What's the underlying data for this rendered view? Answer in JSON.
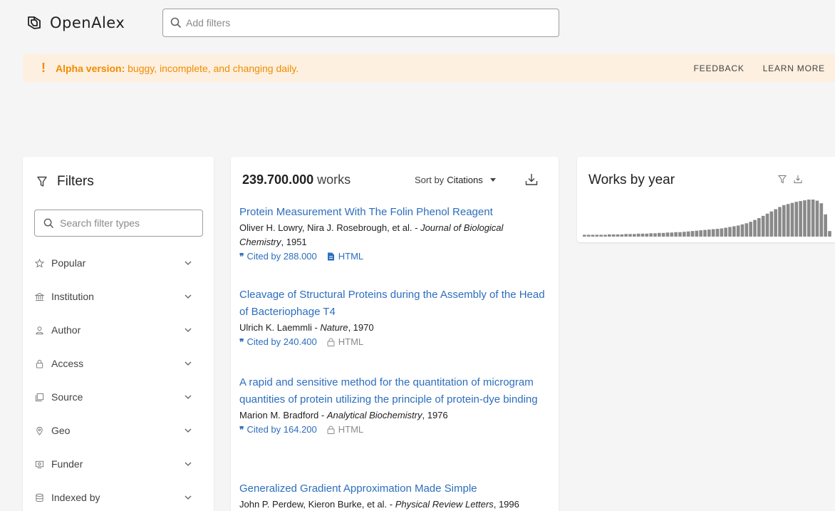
{
  "header": {
    "brand": "OpenAlex",
    "search_placeholder": "Add filters"
  },
  "alpha_banner": {
    "label": "Alpha version:",
    "message": " buggy, incomplete, and changing daily.",
    "feedback": "FEEDBACK",
    "learn_more": "LEARN MORE"
  },
  "filters": {
    "title": "Filters",
    "search_placeholder": "Search filter types",
    "items": [
      {
        "label": "Popular",
        "icon": "star-icon"
      },
      {
        "label": "Institution",
        "icon": "institution-icon"
      },
      {
        "label": "Author",
        "icon": "person-icon"
      },
      {
        "label": "Access",
        "icon": "lock-icon"
      },
      {
        "label": "Source",
        "icon": "source-icon"
      },
      {
        "label": "Geo",
        "icon": "location-icon"
      },
      {
        "label": "Funder",
        "icon": "funder-icon"
      },
      {
        "label": "Indexed by",
        "icon": "database-icon"
      }
    ]
  },
  "results": {
    "count": "239.700.000",
    "count_unit": " works",
    "sort_label": "Sort by",
    "sort_value": "Citations",
    "works": [
      {
        "title": "Protein Measurement With The Folin Phenol Reagent",
        "authors": "Oliver H. Lowry, Nira J. Rosebrough, et al. - ",
        "venue": "Journal of Biological Chemistry",
        "year": ", 1951",
        "cited": "Cited by 288.000",
        "html": "HTML",
        "open_access": true
      },
      {
        "title": "Cleavage of Structural Proteins during the Assembly of the Head of Bacteriophage T4",
        "authors": "Ulrich K. Laemmli - ",
        "venue": "Nature",
        "year": ", 1970",
        "cited": "Cited by 240.400",
        "html": "HTML",
        "open_access": false
      },
      {
        "title": "A rapid and sensitive method for the quantitation of microgram quantities of protein utilizing the principle of protein-dye binding",
        "authors": "Marion M. Bradford - ",
        "venue": "Analytical Biochemistry",
        "year": ", 1976",
        "cited": "Cited by 164.200",
        "html": "HTML",
        "open_access": false
      },
      {
        "title": "Generalized Gradient Approximation Made Simple",
        "authors": "John P. Perdew, Kieron Burke, et al. - ",
        "venue": "Physical Review Letters",
        "year": ", 1996",
        "cited": "",
        "html": "",
        "open_access": true
      }
    ]
  },
  "works_by_year": {
    "title": "Works by year",
    "bar_color": "#8a8a8a",
    "relative_heights": [
      0.05,
      0.05,
      0.05,
      0.05,
      0.05,
      0.05,
      0.06,
      0.06,
      0.06,
      0.06,
      0.07,
      0.07,
      0.07,
      0.08,
      0.08,
      0.08,
      0.09,
      0.09,
      0.1,
      0.1,
      0.11,
      0.11,
      0.12,
      0.12,
      0.13,
      0.14,
      0.15,
      0.16,
      0.17,
      0.18,
      0.19,
      0.2,
      0.21,
      0.22,
      0.24,
      0.26,
      0.28,
      0.3,
      0.33,
      0.36,
      0.4,
      0.45,
      0.5,
      0.56,
      0.62,
      0.68,
      0.74,
      0.8,
      0.85,
      0.88,
      0.91,
      0.94,
      0.96,
      0.98,
      1.0,
      1.0,
      0.97,
      0.9,
      0.6,
      0.15
    ]
  }
}
